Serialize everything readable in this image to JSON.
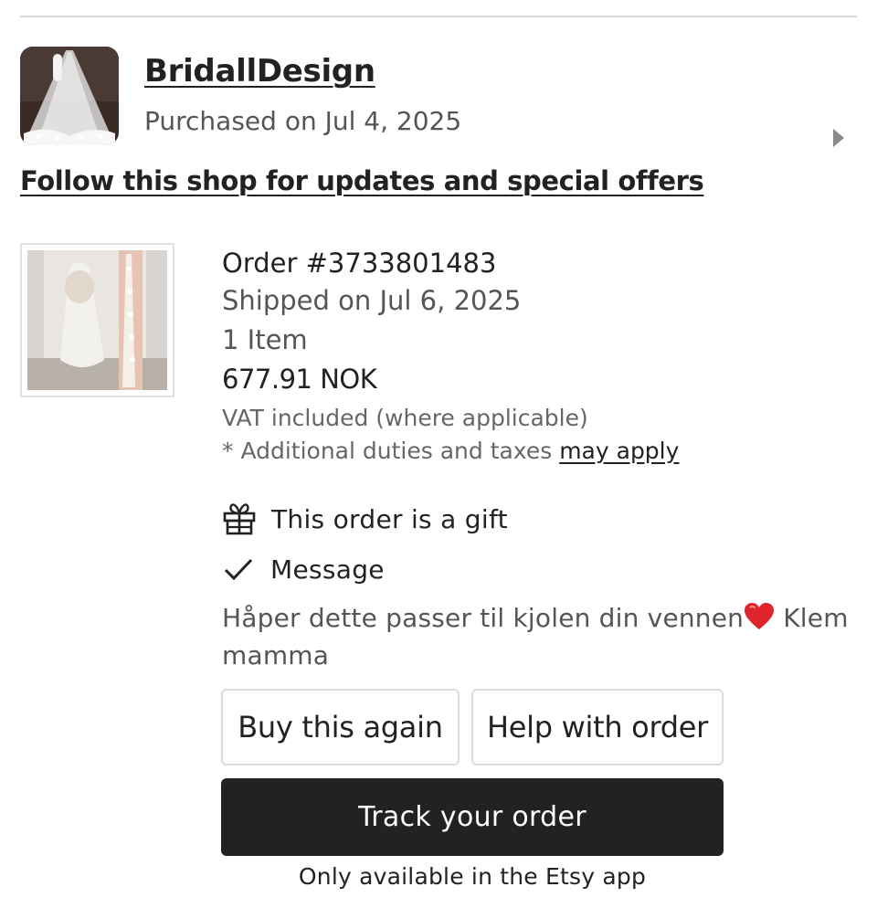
{
  "shop": {
    "name": "BridallDesign",
    "purchased": "Purchased on Jul 4, 2025",
    "follow_text": "Follow this shop for updates and special offers"
  },
  "order": {
    "number": "Order #3733801483",
    "shipped": "Shipped on Jul 6, 2025",
    "item_count": "1 Item",
    "price": "677.91 NOK",
    "vat_note": "VAT included (where applicable)",
    "duties_note": "* Additional duties and taxes",
    "duties_link": "may apply"
  },
  "gift": {
    "label": "This order is a gift",
    "message_label": "Message",
    "message_before": "Håper dette passer til kjolen din vennen",
    "message_after": " Klem mamma"
  },
  "actions": {
    "buy_again": "Buy this again",
    "help": "Help with order",
    "track": "Track your order",
    "app_note": "Only available in the Etsy app"
  },
  "icons": {
    "shop_chevron": "chevron-right-icon",
    "gift": "gift-icon",
    "message_check": "checkmark-icon",
    "heart": "red-heart-emoji"
  },
  "colors": {
    "primary_button": "#222222",
    "divider": "#d9d9d9",
    "heart": "#e0242b"
  }
}
